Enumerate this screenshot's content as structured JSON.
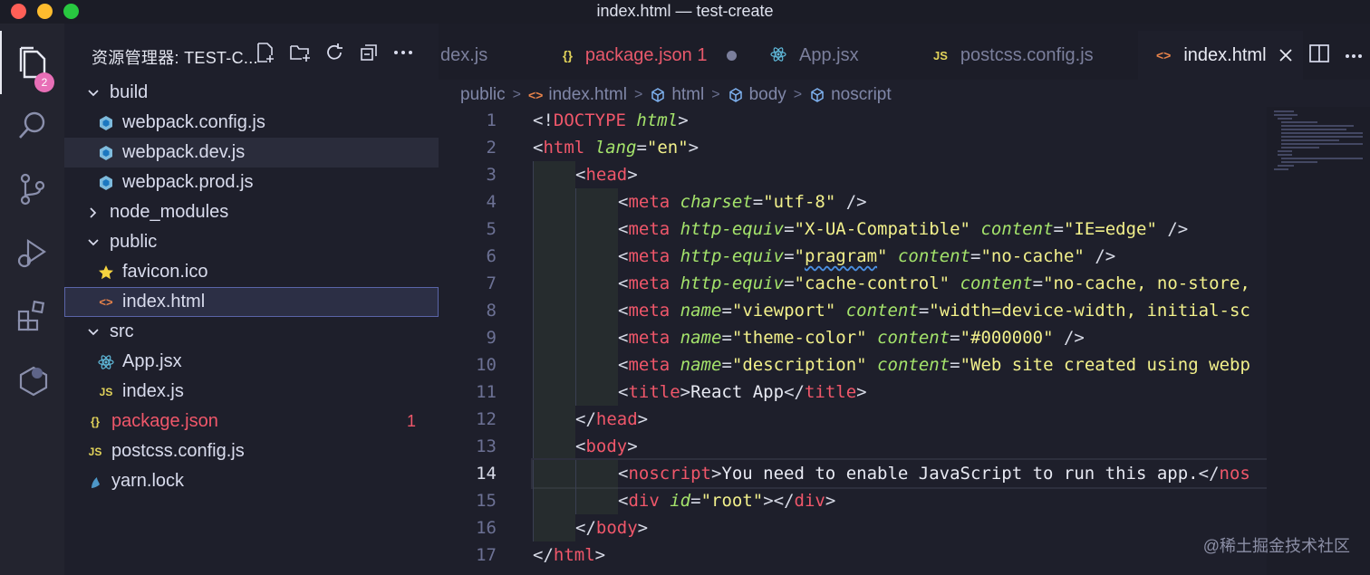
{
  "window": {
    "title": "index.html — test-create"
  },
  "activity": {
    "explorer_badge": "2"
  },
  "sidebar": {
    "title": "资源管理器: TEST-C...",
    "tree": [
      {
        "label": "build",
        "type": "folder-open",
        "depth": 0
      },
      {
        "label": "webpack.config.js",
        "type": "webpack",
        "depth": 1
      },
      {
        "label": "webpack.dev.js",
        "type": "webpack",
        "depth": 1
      },
      {
        "label": "webpack.prod.js",
        "type": "webpack",
        "depth": 1
      },
      {
        "label": "node_modules",
        "type": "folder-closed",
        "depth": 0
      },
      {
        "label": "public",
        "type": "folder-open",
        "depth": 0
      },
      {
        "label": "favicon.ico",
        "type": "star",
        "depth": 1
      },
      {
        "label": "index.html",
        "type": "html",
        "depth": 1
      },
      {
        "label": "src",
        "type": "folder-open",
        "depth": 0
      },
      {
        "label": "App.jsx",
        "type": "react",
        "depth": 1
      },
      {
        "label": "index.js",
        "type": "js",
        "depth": 1
      },
      {
        "label": "package.json",
        "type": "json",
        "depth": 0,
        "count": "1"
      },
      {
        "label": "postcss.config.js",
        "type": "js",
        "depth": 0
      },
      {
        "label": "yarn.lock",
        "type": "yarn",
        "depth": 0
      }
    ]
  },
  "tabs": [
    {
      "label": "dex.js",
      "icon": ""
    },
    {
      "label": "package.json 1",
      "icon": "{}"
    },
    {
      "label": "App.jsx",
      "icon": "react"
    },
    {
      "label": "postcss.config.js",
      "icon": "JS"
    },
    {
      "label": "index.html",
      "icon": "<>"
    }
  ],
  "breadcrumb": [
    "public",
    "index.html",
    "html",
    "body",
    "noscript"
  ],
  "editor": {
    "current_line": 14,
    "lines": [
      {
        "n": "1"
      },
      {
        "n": "2"
      },
      {
        "n": "3"
      },
      {
        "n": "4"
      },
      {
        "n": "5"
      },
      {
        "n": "6"
      },
      {
        "n": "7"
      },
      {
        "n": "8"
      },
      {
        "n": "9"
      },
      {
        "n": "10"
      },
      {
        "n": "11"
      },
      {
        "n": "12"
      },
      {
        "n": "13"
      },
      {
        "n": "14"
      },
      {
        "n": "15"
      },
      {
        "n": "16"
      },
      {
        "n": "17"
      }
    ],
    "code": {
      "l1_doctype": "DOCTYPE",
      "l1_html": "html",
      "l2_tag": "html",
      "l2_attr": "lang",
      "l2_val": "\"en\"",
      "l3_tag": "head",
      "l4_tag": "meta",
      "l4_attr": "charset",
      "l4_val": "\"utf-8\"",
      "l5_tag": "meta",
      "l5_attr1": "http-equiv",
      "l5_val1": "\"X-UA-Compatible\"",
      "l5_attr2": "content",
      "l5_val2": "\"IE=edge\"",
      "l6_tag": "meta",
      "l6_attr1": "http-equiv",
      "l6_q1": "\"",
      "l6_word": "pragram",
      "l6_q2": "\"",
      "l6_attr2": "content",
      "l6_val2": "\"no-cache\"",
      "l7_tag": "meta",
      "l7_attr1": "http-equiv",
      "l7_val1": "\"cache-control\"",
      "l7_attr2": "content",
      "l7_val2": "\"no-cache, no-store,",
      "l8_tag": "meta",
      "l8_attr1": "name",
      "l8_val1": "\"viewport\"",
      "l8_attr2": "content",
      "l8_val2": "\"width=device-width, initial-sc",
      "l9_tag": "meta",
      "l9_attr1": "name",
      "l9_val1": "\"theme-color\"",
      "l9_attr2": "content",
      "l9_val2": "\"#000000\"",
      "l10_tag": "meta",
      "l10_attr1": "name",
      "l10_val1": "\"description\"",
      "l10_attr2": "content",
      "l10_val2": "\"Web site created using webp",
      "l11_tag": "title",
      "l11_text": "React App",
      "l11_close": "title",
      "l12_tag": "head",
      "l13_tag": "body",
      "l14_tag": "noscript",
      "l14_text": "You need to enable JavaScript to run this app.",
      "l14_close": "nos",
      "l15_tag": "div",
      "l15_attr": "id",
      "l15_val": "\"root\"",
      "l15_close": "div",
      "l16_tag": "body",
      "l17_tag": "html"
    }
  },
  "watermark": "@稀土掘金技术社区",
  "colors": {
    "tag": "#f0576a",
    "attr": "#a4e36b",
    "string": "#f2f08b",
    "badge": "#e86fb7"
  }
}
